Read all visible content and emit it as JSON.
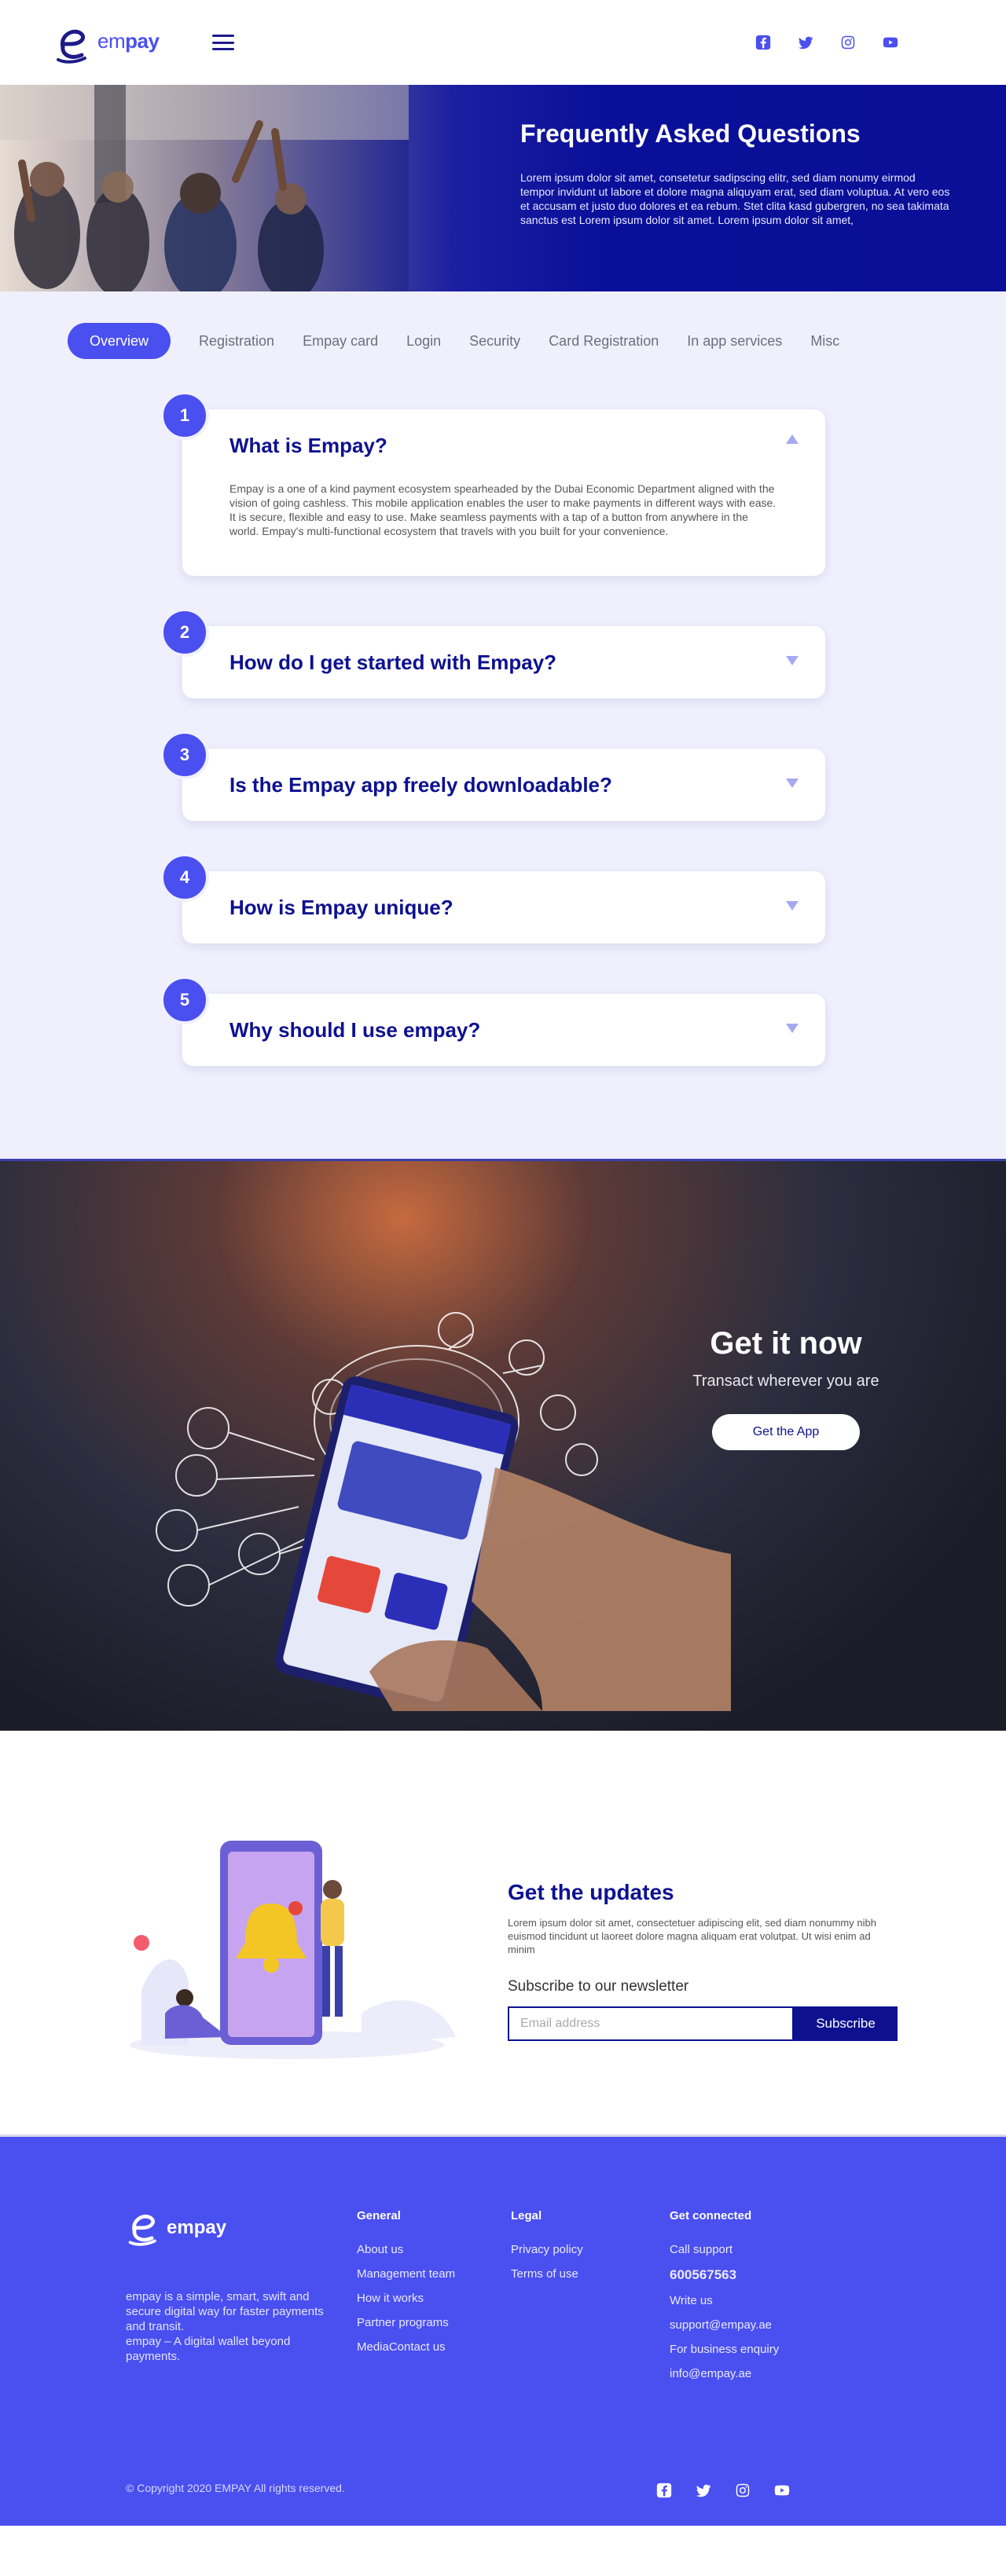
{
  "brand": {
    "name_prefix": "em",
    "name_suffix": "pay",
    "accent": "#4a4ff0",
    "navy": "#0d1190"
  },
  "header": {
    "menu_icon": "hamburger-icon",
    "social": [
      "facebook-icon",
      "twitter-icon",
      "instagram-icon",
      "youtube-icon"
    ]
  },
  "hero": {
    "title": "Frequently Asked Questions",
    "body": "Lorem ipsum dolor sit amet, consetetur sadipscing elitr, sed diam nonumy eirmod tempor invidunt ut labore et dolore magna aliquyam erat, sed diam voluptua. At vero eos et accusam et justo duo dolores et ea rebum. Stet clita kasd gubergren, no sea takimata sanctus est Lorem ipsum dolor sit amet. Lorem ipsum dolor sit amet,"
  },
  "tabs": [
    {
      "label": "Overview",
      "active": true
    },
    {
      "label": "Registration"
    },
    {
      "label": "Empay card"
    },
    {
      "label": "Login"
    },
    {
      "label": "Security"
    },
    {
      "label": "Card Registration"
    },
    {
      "label": "In app services"
    },
    {
      "label": "Misc"
    }
  ],
  "faqs": [
    {
      "num": "1",
      "question": "What is Empay?",
      "expanded": true,
      "answer": "Empay is a one of a kind payment ecosystem spearheaded by the Dubai Economic Department aligned with the vision of going cashless. This mobile application enables the user to make payments in different ways with ease. It is secure, flexible and easy to use. Make seamless payments with a tap of a button from anywhere in the world. Empay's multi-functional ecosystem that travels with you built for your convenience."
    },
    {
      "num": "2",
      "question": "How do I get started with Empay?",
      "expanded": false
    },
    {
      "num": "3",
      "question": "Is the Empay app freely downloadable?",
      "expanded": false
    },
    {
      "num": "4",
      "question": "How is Empay unique?",
      "expanded": false
    },
    {
      "num": "5",
      "question": "Why should I use empay?",
      "expanded": false
    }
  ],
  "getit": {
    "title": "Get it now",
    "subtitle": "Transact wherever you are",
    "button": "Get the App"
  },
  "updates": {
    "title": "Get the updates",
    "body": "Lorem ipsum dolor sit amet, consectetuer adipiscing elit, sed diam nonummy nibh euismod tincidunt ut laoreet dolore magna aliquam erat volutpat. Ut wisi enim ad minim",
    "label": "Subscribe to our newsletter",
    "placeholder": "Email address",
    "button": "Subscribe"
  },
  "footer": {
    "brand_word": "empay",
    "desc_line1": "empay is a simple, smart, swift and secure digital way for faster payments and transit.",
    "desc_line2": "empay – A digital wallet beyond payments.",
    "general": {
      "title": "General",
      "links": [
        "About us",
        "Management team",
        "How it works",
        "Partner programs",
        "MediaContact us"
      ]
    },
    "legal": {
      "title": "Legal",
      "links": [
        "Privacy policy",
        "Terms of use"
      ]
    },
    "connected": {
      "title": "Get connected",
      "call": "Call support",
      "phone": "600567563",
      "write": "Write us",
      "email1": "support@empay.ae",
      "business": "For business enquiry",
      "email2": "info@empay.ae"
    },
    "copyright": "© Copyright 2020 EMPAY All rights reserved."
  }
}
